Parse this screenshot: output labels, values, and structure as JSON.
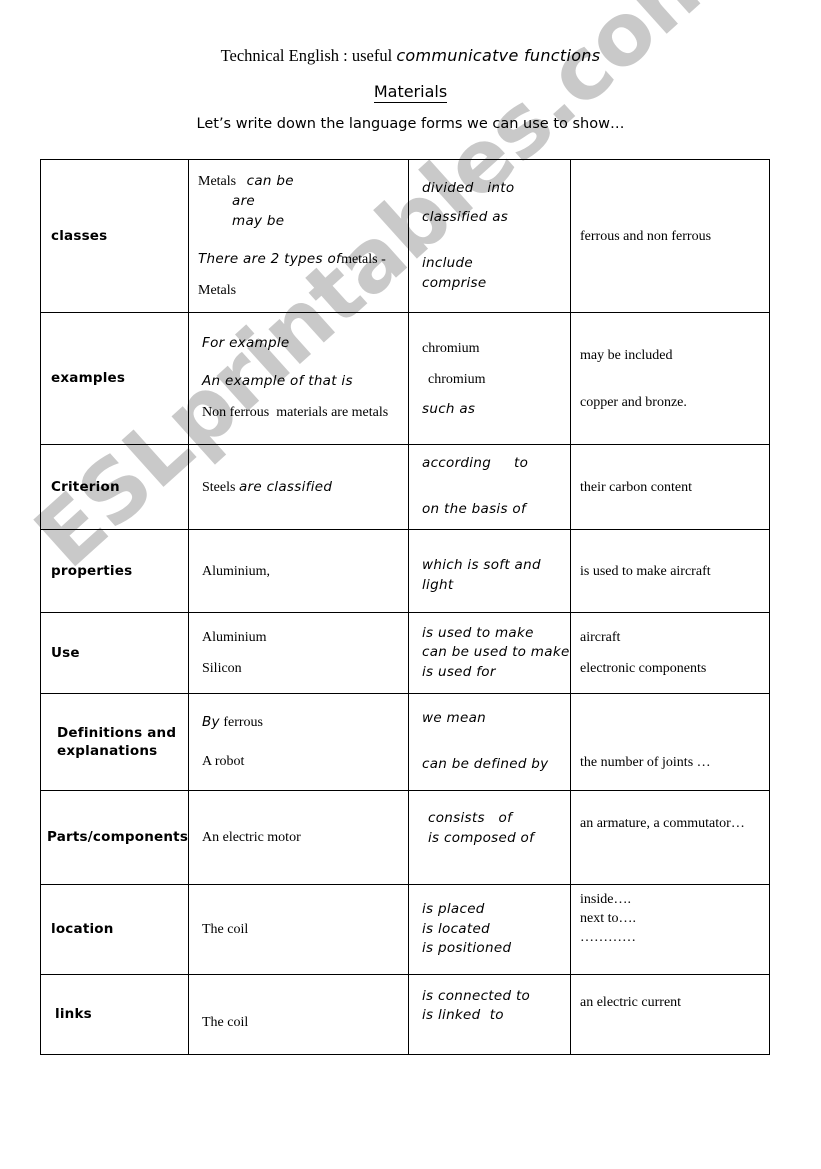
{
  "document": {
    "title_plain": "Technical English  : useful ",
    "title_italic": "communicatve functions",
    "subtitle": "Materials",
    "intro": "Let’s write down the language forms we can use to show…"
  },
  "watermark": {
    "text": "ESLprintables.com",
    "color": "#c9c9c9"
  },
  "table": {
    "rows": [
      {
        "category": "classes",
        "col2": {
          "l1_serif": "Metals",
          "l1_hand": "can be",
          "l2_hand": "are",
          "l3_hand": "may be",
          "l4_hand": "There are 2 types of",
          "l4_serif": "metals -",
          "l5_serif": "Metals"
        },
        "col3": {
          "l1": "divided   into",
          "l2": "classified as",
          "l3": "include",
          "l4": "comprise"
        },
        "col4": {
          "l1": "ferrous and non ferrous"
        }
      },
      {
        "category": "examples",
        "col2": {
          "l1_hand": "For example",
          "l2_hand": "An example of that is",
          "l3_serif": "Non ferrous  materials are metals"
        },
        "col3": {
          "l1_serif": "chromium",
          "l2_serif": "chromium",
          "l3_hand": "such as"
        },
        "col4": {
          "l1": "may be included",
          "l2": "copper and bronze."
        }
      },
      {
        "category": "Criterion",
        "col2": {
          "l1_serif": "Steels",
          "l1_hand": "are classified"
        },
        "col3": {
          "l1": "according     to",
          "l2": "on the basis of"
        },
        "col4": {
          "l1": "their carbon content"
        }
      },
      {
        "category": "properties",
        "col2": {
          "l1_serif": "Aluminium,"
        },
        "col3": {
          "l1": "which is soft and",
          "l2": "light"
        },
        "col4": {
          "l1": "is used to make aircraft"
        }
      },
      {
        "category": "Use",
        "col2": {
          "l1_serif": "Aluminium",
          "l2_serif": "Silicon"
        },
        "col3": {
          "l1": "is used to make",
          "l2": "can be used to make",
          "l3": "is used for"
        },
        "col4": {
          "l1": "aircraft",
          "l2": "electronic components"
        }
      },
      {
        "category": "Definitions and explanations",
        "col2": {
          "l1_hand": "By",
          "l1_serif": "ferrous",
          "l2_serif": "A robot"
        },
        "col3": {
          "l1": "we mean",
          "l2": "can be defined by"
        },
        "col4": {
          "l1": "the number of joints …"
        }
      },
      {
        "category": "Parts/components",
        "col2": {
          "l1_serif": "An electric motor"
        },
        "col3": {
          "l1": "consists   of",
          "l2": "is composed of"
        },
        "col4": {
          "l1": "an armature, a commutator…"
        }
      },
      {
        "category": "location",
        "col2": {
          "l1_serif": "The coil"
        },
        "col3": {
          "l1": "is placed",
          "l2": "is located",
          "l3": "is positioned"
        },
        "col4": {
          "l1": "inside….",
          "l2": "next to….",
          "l3": "…………"
        }
      },
      {
        "category": "links",
        "col2": {
          "l1_serif": "The coil"
        },
        "col3": {
          "l1": "is connected to",
          "l2": "is linked  to"
        },
        "col4": {
          "l1": "an electric current"
        }
      }
    ]
  }
}
